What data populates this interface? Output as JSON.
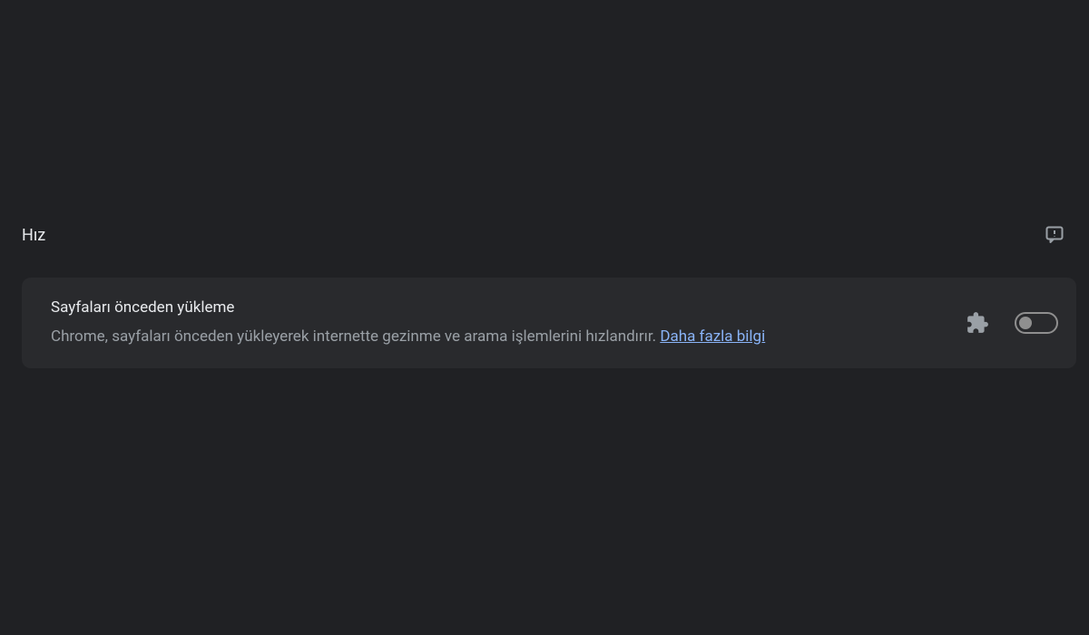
{
  "section": {
    "title": "Hız"
  },
  "card": {
    "title": "Sayfaları önceden yükleme",
    "description": "Chrome, sayfaları önceden yükleyerek internette gezinme ve arama işlemlerini hızlandırır. ",
    "learn_more": "Daha fazla bilgi",
    "toggle_state": "off"
  }
}
